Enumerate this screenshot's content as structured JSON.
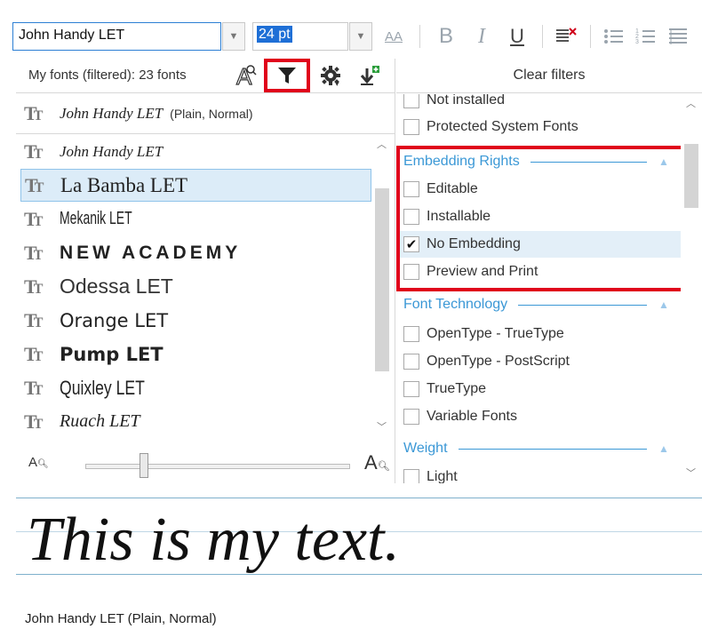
{
  "toolbar": {
    "font_name": "John Handy LET",
    "font_size": "24 pt",
    "font_size_icon": "AA",
    "bold": "B",
    "italic": "I",
    "underline": "U"
  },
  "font_list": {
    "header": "My fonts (filtered): 23 fonts",
    "current_font": {
      "name": "John Handy LET",
      "style": "(Plain, Normal)"
    },
    "items": [
      {
        "name": "John Handy LET"
      },
      {
        "name": "La Bamba LET"
      },
      {
        "name": "Mekanik LET"
      },
      {
        "name": "NEW ACADEMY"
      },
      {
        "name": "Odessa LET"
      },
      {
        "name": "Orange LET"
      },
      {
        "name": "Pump LET"
      },
      {
        "name": "Quixley LET"
      },
      {
        "name": "Ruach LET"
      }
    ],
    "selected_index": 1,
    "zoom_level": 0.22
  },
  "filters": {
    "clear_label": "Clear filters",
    "top_partial": "Not installed",
    "protected": "Protected System Fonts",
    "sections": {
      "embedding": {
        "title": "Embedding Rights",
        "options": [
          {
            "label": "Editable",
            "checked": false
          },
          {
            "label": "Installable",
            "checked": false
          },
          {
            "label": "No Embedding",
            "checked": true
          },
          {
            "label": "Preview and Print",
            "checked": false
          }
        ]
      },
      "technology": {
        "title": "Font Technology",
        "options": [
          {
            "label": "OpenType - TrueType",
            "checked": false
          },
          {
            "label": "OpenType - PostScript",
            "checked": false
          },
          {
            "label": "TrueType",
            "checked": false
          },
          {
            "label": "Variable Fonts",
            "checked": false
          }
        ]
      },
      "weight": {
        "title": "Weight",
        "options": [
          {
            "label": "Light",
            "checked": false
          }
        ]
      }
    }
  },
  "preview": {
    "text": "This is my text.",
    "caption": "John Handy LET (Plain, Normal)"
  },
  "colors": {
    "accent": "#3b98d6",
    "highlight": "#e0001b",
    "selection": "#dcecf8"
  }
}
